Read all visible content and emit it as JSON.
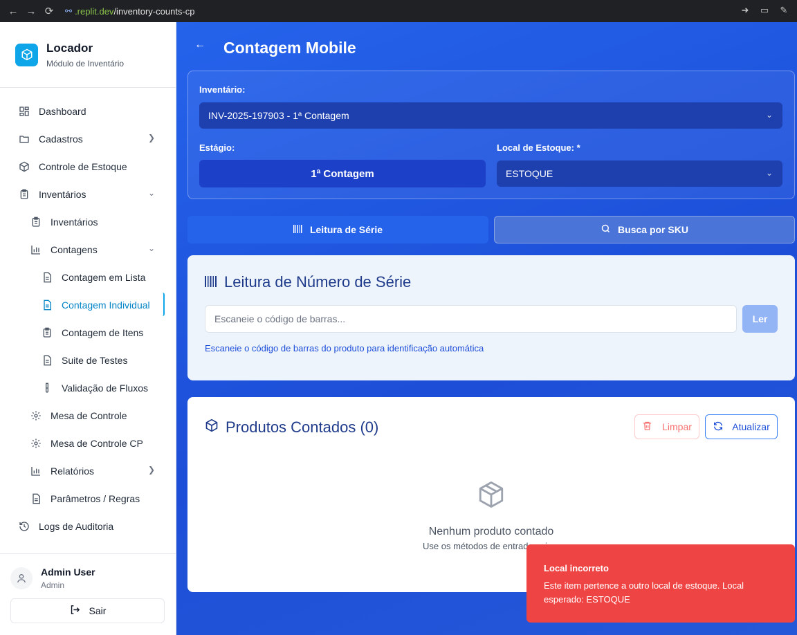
{
  "browser": {
    "url_prefix": ".replit.dev",
    "url_path": "/inventory-counts-cp"
  },
  "brand": {
    "title": "Locador",
    "subtitle": "Módulo de Inventário",
    "color": "#0ea5e9"
  },
  "sidebar": {
    "items": [
      {
        "label": "Dashboard",
        "icon": "grid-icon"
      },
      {
        "label": "Cadastros",
        "icon": "folder-icon"
      },
      {
        "label": "Controle de Estoque",
        "icon": "box-icon"
      },
      {
        "label": "Inventários",
        "icon": "clipboard-icon"
      },
      {
        "label": "Inventários",
        "icon": "clipboard-icon"
      },
      {
        "label": "Contagens",
        "icon": "bar-chart-icon"
      },
      {
        "label": "Contagem em Lista",
        "icon": "document-icon"
      },
      {
        "label": "Contagem Individual",
        "icon": "document-icon"
      },
      {
        "label": "Contagem de Itens",
        "icon": "clipboard-icon"
      },
      {
        "label": "Suite de Testes",
        "icon": "document-icon"
      },
      {
        "label": "Validação de Fluxos",
        "icon": "test-tube-icon"
      },
      {
        "label": "Mesa de Controle",
        "icon": "gear-icon"
      },
      {
        "label": "Mesa de Controle CP",
        "icon": "gear-icon"
      },
      {
        "label": "Relatórios",
        "icon": "bar-chart-icon"
      },
      {
        "label": "Parâmetros / Regras",
        "icon": "document-icon"
      },
      {
        "label": "Logs de Auditoria",
        "icon": "history-icon"
      }
    ]
  },
  "user": {
    "name": "Admin User",
    "role": "Admin",
    "logout_label": "Sair"
  },
  "header": {
    "title": "Contagem Mobile"
  },
  "form": {
    "inventory_label": "Inventário:",
    "inventory_value": "INV-2025-197903 - 1ª Contagem",
    "stage_label": "Estágio:",
    "stage_value": "1ª Contagem",
    "location_label": "Local de Estoque: *",
    "location_value": "ESTOQUE"
  },
  "tabs": {
    "serial": "Leitura de Série",
    "sku": "Busca por SKU"
  },
  "scan": {
    "title": "Leitura de Número de Série",
    "placeholder": "Escaneie o código de barras...",
    "read_label": "Ler",
    "hint": "Escaneie o código de barras do produto para identificação automática"
  },
  "products": {
    "title": "Produtos Contados (0)",
    "clear_label": "Limpar",
    "refresh_label": "Atualizar",
    "empty_title": "Nenhum produto contado",
    "empty_sub": "Use os métodos de entrada acima"
  },
  "toast": {
    "title": "Local incorreto",
    "message": "Este item pertence a outro local de estoque. Local esperado: ESTOQUE",
    "color": "#ef4444"
  }
}
